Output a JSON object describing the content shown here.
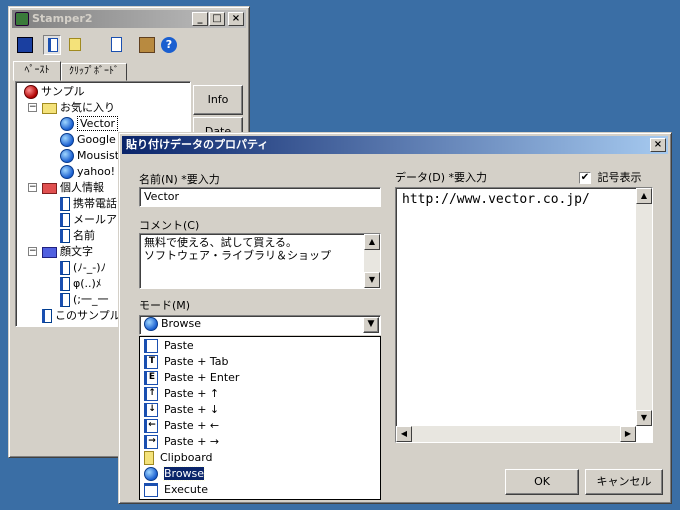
{
  "main_window": {
    "title": "Stamper2",
    "tabs": [
      "ﾍﾟｰｽﾄ",
      "ｸﾘｯﾌﾟﾎﾞｰﾄﾞ"
    ],
    "side_buttons": [
      "Info",
      "Date"
    ],
    "tree": [
      {
        "label": "サンプル",
        "icon": "ball-icon",
        "level": 0
      },
      {
        "label": "お気に入り",
        "icon": "folder-icon",
        "level": 1
      },
      {
        "label": "Vector",
        "icon": "globe-icon",
        "level": 2,
        "selected": true
      },
      {
        "label": "Google",
        "icon": "globe-icon",
        "level": 2
      },
      {
        "label": "Mousist",
        "icon": "globe-icon",
        "level": 2
      },
      {
        "label": "yahoo!",
        "icon": "globe-icon",
        "level": 2
      },
      {
        "label": "個人情報",
        "icon": "folder-icon",
        "level": 1
      },
      {
        "label": "携帯電話",
        "icon": "document-icon",
        "level": 2
      },
      {
        "label": "メールア",
        "icon": "document-icon",
        "level": 2
      },
      {
        "label": "名前",
        "icon": "document-icon",
        "level": 2
      },
      {
        "label": "顔文字",
        "icon": "folder-icon",
        "level": 1
      },
      {
        "label": "(ﾉ-_-)ﾉ",
        "icon": "document-icon",
        "level": 2
      },
      {
        "label": "φ(..)ﾒ",
        "icon": "document-icon",
        "level": 2
      },
      {
        "label": "(;一_一",
        "icon": "document-icon",
        "level": 2
      },
      {
        "label": "このサンプル",
        "icon": "document-icon",
        "level": 1
      }
    ]
  },
  "dialog": {
    "title": "貼り付けデータのプロパティ",
    "name_label": "名前(N)  *要入力",
    "name_value": "Vector",
    "comment_label": "コメント(C)",
    "comment_lines": [
      "無料で使える、試して買える。",
      "ソフトウェア・ライブラリ＆ショップ"
    ],
    "mode_label": "モード(M)",
    "mode_value": "Browse",
    "mode_options": [
      {
        "label": "Paste",
        "icon": ""
      },
      {
        "label": "Paste + Tab",
        "icon": "T"
      },
      {
        "label": "Paste + Enter",
        "icon": "E"
      },
      {
        "label": "Paste + ↑",
        "icon": "↑"
      },
      {
        "label": "Paste + ↓",
        "icon": "↓"
      },
      {
        "label": "Paste + ←",
        "icon": "←"
      },
      {
        "label": "Paste + →",
        "icon": "→"
      },
      {
        "label": "Clipboard",
        "icon": "clipboard"
      },
      {
        "label": "Browse",
        "icon": "globe",
        "selected": true
      },
      {
        "label": "Execute",
        "icon": "window"
      }
    ],
    "data_label": "データ(D)  *要入力",
    "symbol_display_label": "記号表示",
    "symbol_display_checked": true,
    "data_value": "http://www.vector.co.jp/",
    "ok_label": "OK",
    "cancel_label": "キャンセル"
  }
}
